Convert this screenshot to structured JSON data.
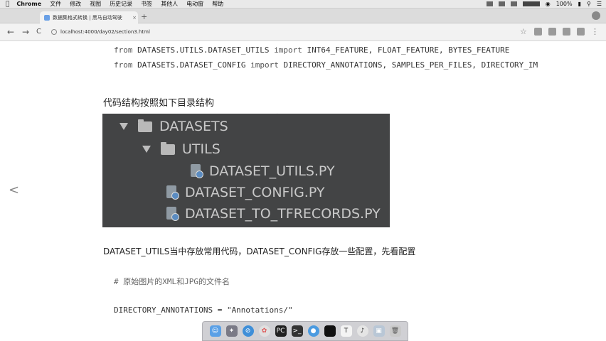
{
  "menubar": {
    "app": "Chrome",
    "items": [
      "文件",
      "修改",
      "视图",
      "历史记录",
      "书签",
      "其他人",
      "电动窗",
      "帮助"
    ],
    "battery": "100%"
  },
  "tab": {
    "title": "数据集格式转换 | 黑马自动驾驶",
    "close": "×"
  },
  "toolbar": {
    "back": "←",
    "forward": "→",
    "reload": "C",
    "url": "localhost:4000/day02/section3.html"
  },
  "content": {
    "code_line1_from": "from",
    "code_line1_module": " DATASETS.UTILS.DATASET_UTILS ",
    "code_line1_import": "import",
    "code_line1_names": " INT64_FEATURE, FLOAT_FEATURE, BYTES_FEATURE",
    "code_line2_from": "from",
    "code_line2_module": " DATASETS.DATASET_CONFIG ",
    "code_line2_import": "import",
    "code_line2_names": " DIRECTORY_ANNOTATIONS, SAMPLES_PER_FILES, DIRECTORY_IM",
    "heading": "代码结构按照如下目录结构",
    "tree": {
      "root": "DATASETS",
      "sub": "UTILS",
      "file_utils": "DATASET_UTILS.PY",
      "file_config": "DATASET_CONFIG.PY",
      "file_tfrecords": "DATASET_TO_TFRECORDS.PY"
    },
    "paragraph": "DATASET_UTILS当中存放常用代码，DATASET_CONFIG存放一些配置，先看配置",
    "comment": "# 原始图片的XML和JPG的文件名",
    "assign": "DIRECTORY_ANNOTATIONS = \"Annotations/\"",
    "side_arrow": "<"
  },
  "dock": {
    "icons": [
      "finder-icon",
      "launchpad-icon",
      "safari-icon",
      "photos-icon",
      "pycharm-icon",
      "terminal-icon",
      "chrome-icon",
      "app-icon",
      "typora-icon",
      "music-icon",
      "preview-icon",
      "trash-icon"
    ]
  }
}
